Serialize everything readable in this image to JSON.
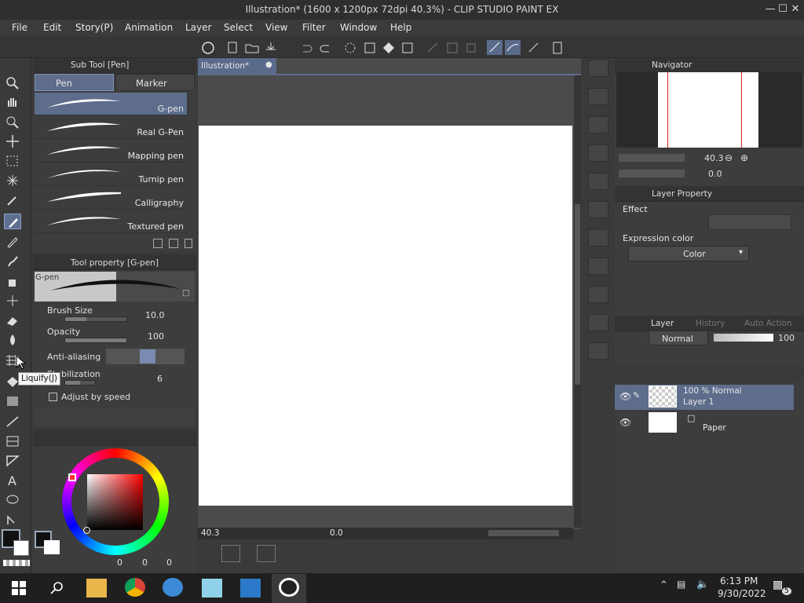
{
  "window": {
    "title": "Illustration* (1600 x 1200px 72dpi 40.3%) - CLIP STUDIO PAINT EX",
    "minimize": "—",
    "maximize": "☐",
    "close": "✕"
  },
  "menu": [
    "File",
    "Edit",
    "Story(P)",
    "Animation",
    "Layer",
    "Select",
    "View",
    "Filter",
    "Window",
    "Help"
  ],
  "subtool": {
    "header": "Sub Tool [Pen]",
    "tab_pen": "Pen",
    "tab_marker": "Marker",
    "brushes": [
      "G-pen",
      "Real G-Pen",
      "Mapping pen",
      "Turnip pen",
      "Calligraphy",
      "Textured pen"
    ]
  },
  "toolprop": {
    "header": "Tool property [G-pen]",
    "preview_label": "G-pen",
    "brush_size_label": "Brush Size",
    "brush_size_value": "10.0",
    "opacity_label": "Opacity",
    "opacity_value": "100",
    "antialiasing_label": "Anti-aliasing",
    "stabilization_label": "Stabilization",
    "stabilization_value": "6",
    "adjust_speed_label": "Adjust by speed"
  },
  "tooltip": "Liquify(J)",
  "document": {
    "tab_label": "Illustration*",
    "zoom_value": "40.3",
    "rotation_value": "0.0"
  },
  "navigator": {
    "header": "Navigator",
    "zoom_value": "40.3",
    "rotation_value": "0.0"
  },
  "layer_property": {
    "header": "Layer Property",
    "effect_label": "Effect",
    "expression_color_label": "Expression color",
    "expression_color_value": "Color"
  },
  "layer_panel": {
    "header": "Layer",
    "tab_history": "History",
    "tab_auto_action": "Auto Action",
    "blend_mode": "Normal",
    "opacity_value": "100",
    "layers": [
      {
        "line1": "100 % Normal",
        "line2": "Layer 1"
      },
      {
        "line1": "",
        "line2": "Paper"
      }
    ]
  },
  "color": {
    "sub_a": "0",
    "sub_b": "0",
    "sub_c": "0"
  },
  "taskbar": {
    "time": "6:13 PM",
    "date": "9/30/2022",
    "notification_count": "5"
  },
  "colors": {
    "accent": "#5e6d8c",
    "panel": "#3d3d3d",
    "canvas": "#ffffff"
  }
}
